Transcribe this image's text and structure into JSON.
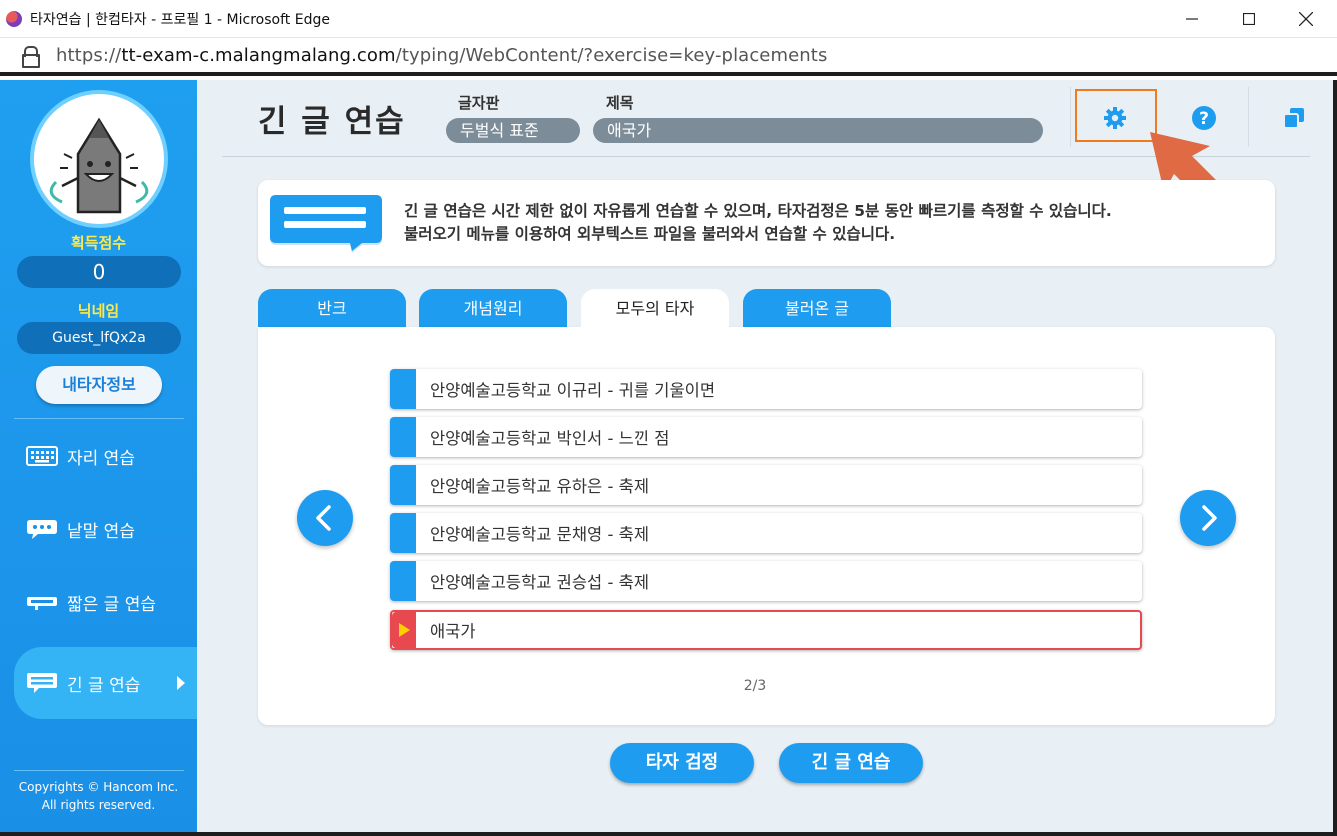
{
  "window": {
    "title": "타자연습 | 한컴타자 - 프로필 1 - Microsoft Edge",
    "minimize_icon": "minimize-icon",
    "maximize_icon": "maximize-icon",
    "close_icon": "close-icon"
  },
  "address": {
    "url_scheme": "https://",
    "url_host": "tt-exam-c.malangmalang.com",
    "url_path": "/typing/WebContent/?exercise=key-placements"
  },
  "sidebar": {
    "score_label": "획득점수",
    "score_value": "0",
    "nickname_label": "닉네임",
    "nickname_value": "Guest_lfQx2a",
    "mypage_button": "내타자정보",
    "menu": [
      {
        "label": "자리 연습",
        "icon": "keyboard-icon"
      },
      {
        "label": "낱말 연습",
        "icon": "chat-bubble-icon"
      },
      {
        "label": "짧은 글 연습",
        "icon": "short-text-icon"
      },
      {
        "label": "긴 글 연습",
        "icon": "long-text-icon"
      }
    ],
    "copyright_line1": "Copyrights © Hancom Inc.",
    "copyright_line2": "All rights reserved."
  },
  "header": {
    "title": "긴 글 연습",
    "keyboard_label": "글자판",
    "keyboard_value": "두벌식 표준",
    "subject_label": "제목",
    "subject_value": "애국가"
  },
  "info": {
    "line1": "긴 글 연습은 시간 제한 없이 자유롭게 연습할 수 있으며, 타자검정은 5분 동안 빠르기를 측정할 수 있습니다.",
    "line2": "불러오기 메뉴를 이용하여 외부텍스트 파일을 불러와서 연습할 수 있습니다."
  },
  "tabs": [
    {
      "label": "반크"
    },
    {
      "label": "개념원리"
    },
    {
      "label": "모두의 타자"
    },
    {
      "label": "불러온 글"
    }
  ],
  "list": [
    {
      "label": "안양예술고등학교 이규리 - 귀를 기울이면"
    },
    {
      "label": "안양예술고등학교 박인서 - 느낀 점"
    },
    {
      "label": "안양예술고등학교 유하은 - 축제"
    },
    {
      "label": "안양예술고등학교 문채영 - 축제"
    },
    {
      "label": "안양예술고등학교 권승섭 - 축제"
    },
    {
      "label": "애국가"
    }
  ],
  "pagination": "2/3",
  "buttons": {
    "test": "타자 검정",
    "practice": "긴 글 연습"
  },
  "colors": {
    "primary": "#1e9cf0",
    "highlight": "#f07a1c",
    "selected": "#e8494f",
    "annotation_arrow": "#e06a44"
  }
}
